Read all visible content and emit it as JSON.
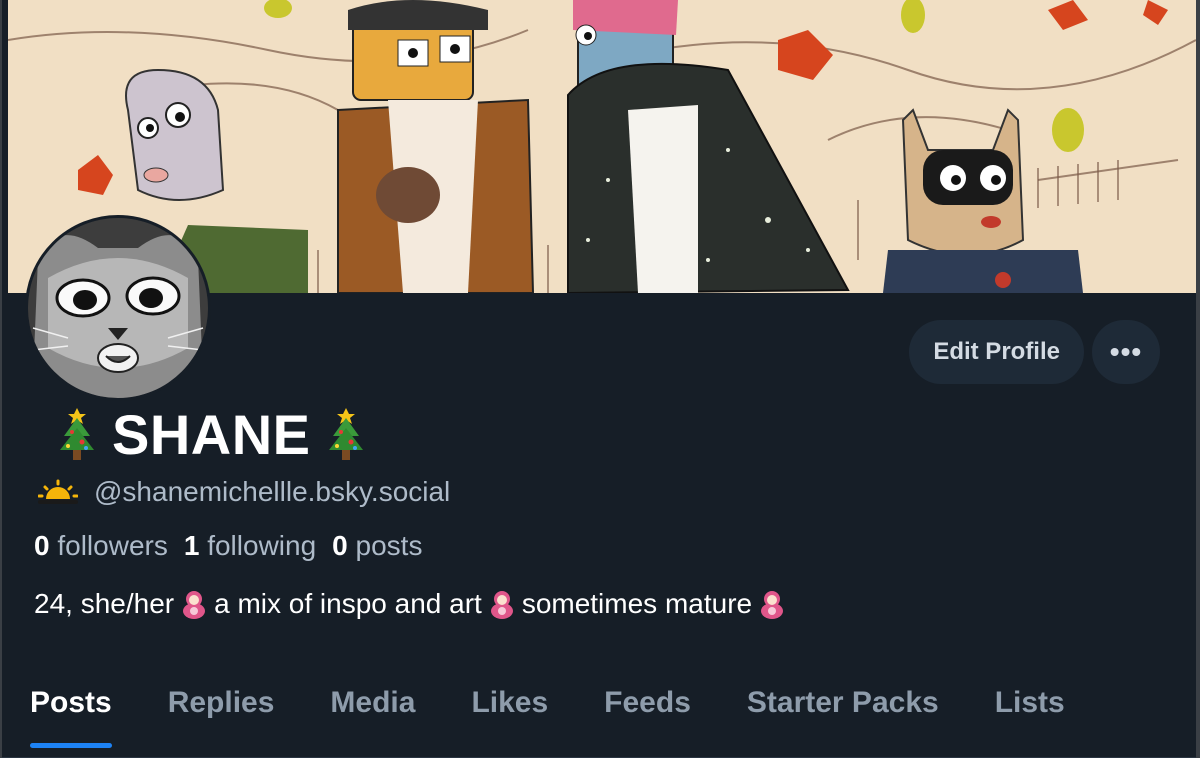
{
  "profile": {
    "display_name": "SHANE",
    "name_emoji": "christmas-tree",
    "handle": "@shanemichellle.bsky.social",
    "handle_emoji": "sunrise"
  },
  "stats": {
    "followers_count": "0",
    "followers_label": "followers",
    "following_count": "1",
    "following_label": "following",
    "posts_count": "0",
    "posts_label": "posts"
  },
  "bio": {
    "part1": "24, she/her ",
    "part2": " a mix of inspo and art",
    "part3": " sometimes mature",
    "emoji": "nesting-doll"
  },
  "actions": {
    "edit_label": "Edit Profile",
    "more_label": "•••"
  },
  "tabs": [
    {
      "label": "Posts",
      "active": true
    },
    {
      "label": "Replies"
    },
    {
      "label": "Media"
    },
    {
      "label": "Likes"
    },
    {
      "label": "Feeds"
    },
    {
      "label": "Starter Packs"
    },
    {
      "label": "Lists"
    }
  ],
  "colors": {
    "background": "#161e27",
    "button_bg": "#1e2a37",
    "accent": "#1d83f5",
    "muted_text": "#8e9cab"
  }
}
